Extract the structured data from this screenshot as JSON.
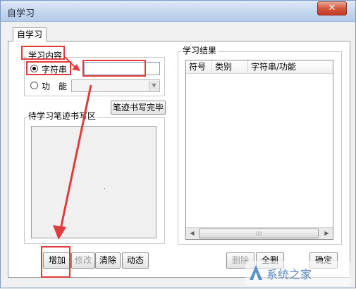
{
  "window": {
    "title": "自学习",
    "close_icon": "close-icon"
  },
  "tab": {
    "label": "自学习"
  },
  "learn_content": {
    "group_label": "学习内容",
    "string_option": "字符串",
    "string_value": "",
    "function_option": "功　能",
    "function_value": "",
    "selected": "string"
  },
  "writing": {
    "done_button": "笔迹书写完毕",
    "area_label": "待学习笔迹书写区"
  },
  "bottom_buttons": {
    "add": "增加",
    "modify": "修改",
    "clear": "清除",
    "dynamic": "动态"
  },
  "results": {
    "group_label": "学习结果",
    "columns": [
      "符号",
      "类别",
      "字符串/功能"
    ],
    "rows": []
  },
  "result_buttons": {
    "delete": "删除",
    "all": "全删",
    "confirm": "确定"
  },
  "watermark": {
    "text": "系统之家"
  },
  "colors": {
    "annotation": "#e23b3b",
    "title_bar": "#c4d6ee",
    "close_button": "#c43a22"
  }
}
